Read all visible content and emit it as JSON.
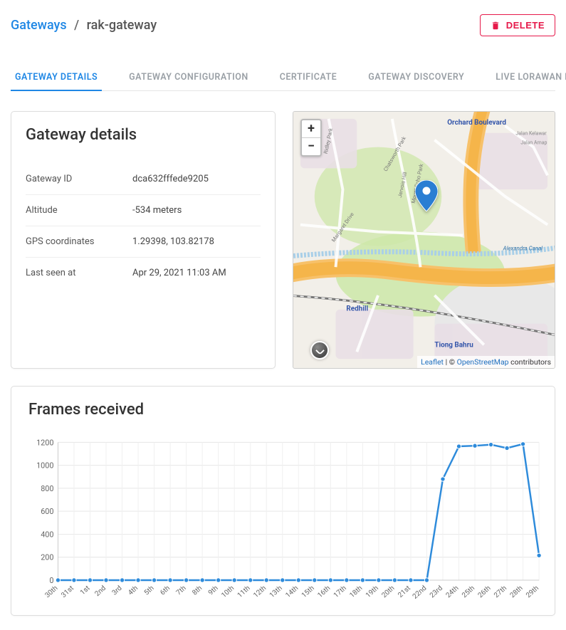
{
  "breadcrumb": {
    "root": "Gateways",
    "current": "rak-gateway"
  },
  "buttons": {
    "delete": "DELETE"
  },
  "tabs": [
    {
      "label": "GATEWAY DETAILS",
      "active": true
    },
    {
      "label": "GATEWAY CONFIGURATION",
      "active": false
    },
    {
      "label": "CERTIFICATE",
      "active": false
    },
    {
      "label": "GATEWAY DISCOVERY",
      "active": false
    },
    {
      "label": "LIVE LORAWAN FRAMES",
      "active": false
    }
  ],
  "details": {
    "title": "Gateway details",
    "rows": [
      {
        "label": "Gateway ID",
        "value": "dca632fffede9205"
      },
      {
        "label": "Altitude",
        "value": "-534 meters"
      },
      {
        "label": "GPS coordinates",
        "value": "1.29398, 103.82178"
      },
      {
        "label": "Last seen at",
        "value": "Apr 29, 2021 11:03 AM"
      }
    ]
  },
  "map": {
    "zoom_in": "+",
    "zoom_out": "−",
    "attrib_leaflet": "Leaflet",
    "attrib_sep": " | © ",
    "attrib_osm": "OpenStreetMap",
    "attrib_suffix": " contributors",
    "labels": {
      "orchard": "Orchard Boulevard",
      "redhill": "Redhill",
      "tiong": "Tiong Bahru",
      "alexandra": "Alexandra Canal",
      "ridley": "Ridley Park",
      "jervois": "Jervois Hill",
      "chatsworth": "Chatsworth Park",
      "margaret": "Margaret Drive",
      "jalan_kelawar": "Jalan Kelawar",
      "jalan_arnap": "Jalan Arnap",
      "mount_echo": "Mount Echo Park"
    }
  },
  "frames": {
    "title": "Frames received"
  },
  "chart_data": {
    "type": "line",
    "title": "Frames received",
    "ylabel": "",
    "xlabel": "",
    "ylim": [
      0,
      1200
    ],
    "yticks": [
      0,
      200,
      400,
      600,
      800,
      1000,
      1200
    ],
    "categories": [
      "30th",
      "31st",
      "1st",
      "2nd",
      "3rd",
      "4th",
      "5th",
      "6th",
      "7th",
      "8th",
      "9th",
      "10th",
      "11th",
      "12th",
      "13th",
      "14th",
      "15th",
      "16th",
      "17th",
      "18th",
      "19th",
      "20th",
      "21st",
      "22nd",
      "23rd",
      "24th",
      "25th",
      "26th",
      "27th",
      "28th",
      "29th"
    ],
    "values": [
      0,
      0,
      0,
      0,
      0,
      0,
      0,
      0,
      0,
      0,
      0,
      0,
      0,
      0,
      0,
      0,
      0,
      0,
      0,
      0,
      0,
      0,
      0,
      0,
      880,
      1165,
      1170,
      1180,
      1150,
      1185,
      215
    ]
  },
  "colors": {
    "accent": "#1f87e5",
    "danger": "#e6194a",
    "chart_line": "#2e8bdb"
  }
}
